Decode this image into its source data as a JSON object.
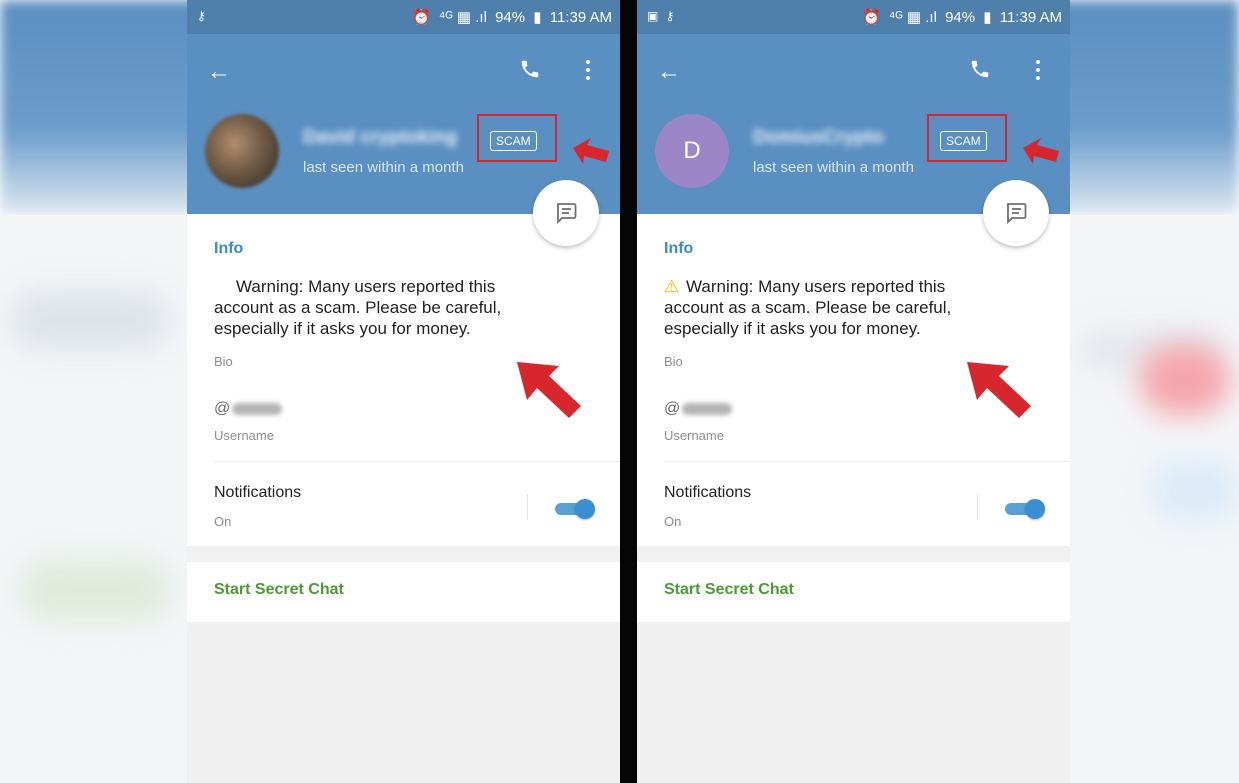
{
  "screens": [
    {
      "status": {
        "time": "11:39 AM",
        "battery": "94%",
        "left_icons": "⚷",
        "network": "⁴ᴳ ▦ .ıl"
      },
      "profile": {
        "name": "David cryptoking",
        "badge": "SCAM",
        "last_seen": "last seen within a month",
        "avatar_type": "photo",
        "avatar_letter": ""
      },
      "info": {
        "section_title": "Info",
        "warning_icon": "",
        "bio_text": "Warning: Many users reported this account as a scam. Please be careful, especially if it asks you for money.",
        "bio_label": "Bio",
        "username_prefix": "@",
        "username_label": "Username"
      },
      "notifications": {
        "title": "Notifications",
        "state": "On",
        "enabled": true
      },
      "secret_chat_label": "Start Secret Chat"
    },
    {
      "status": {
        "time": "11:39 AM",
        "battery": "94%",
        "left_icons": "▣ ⚷",
        "network": "⁴ᴳ ▦ .ıl"
      },
      "profile": {
        "name": "DomiusCrypto",
        "badge": "SCAM",
        "last_seen": "last seen within a month",
        "avatar_type": "letter",
        "avatar_letter": "D"
      },
      "info": {
        "section_title": "Info",
        "warning_icon": "⚠",
        "bio_text": "Warning: Many users reported this account as a scam. Please be careful, especially if it asks you for money.",
        "bio_label": "Bio",
        "username_prefix": "@",
        "username_label": "Username"
      },
      "notifications": {
        "title": "Notifications",
        "state": "On",
        "enabled": true
      },
      "secret_chat_label": "Start Secret Chat"
    }
  ],
  "colors": {
    "header": "#5a8fc1",
    "accent_blue": "#3e8ac4",
    "secret_green": "#4c9a35",
    "highlight_red": "#d62431",
    "avatar_purple": "#9b86c8",
    "toggle_blue": "#3a8fd2"
  },
  "icons": {
    "back": "arrow-left-icon",
    "call": "phone-icon",
    "more": "more-vertical-icon",
    "fab": "message-icon",
    "warning": "warning-triangle-icon",
    "annotation": "red-arrow-icon"
  }
}
